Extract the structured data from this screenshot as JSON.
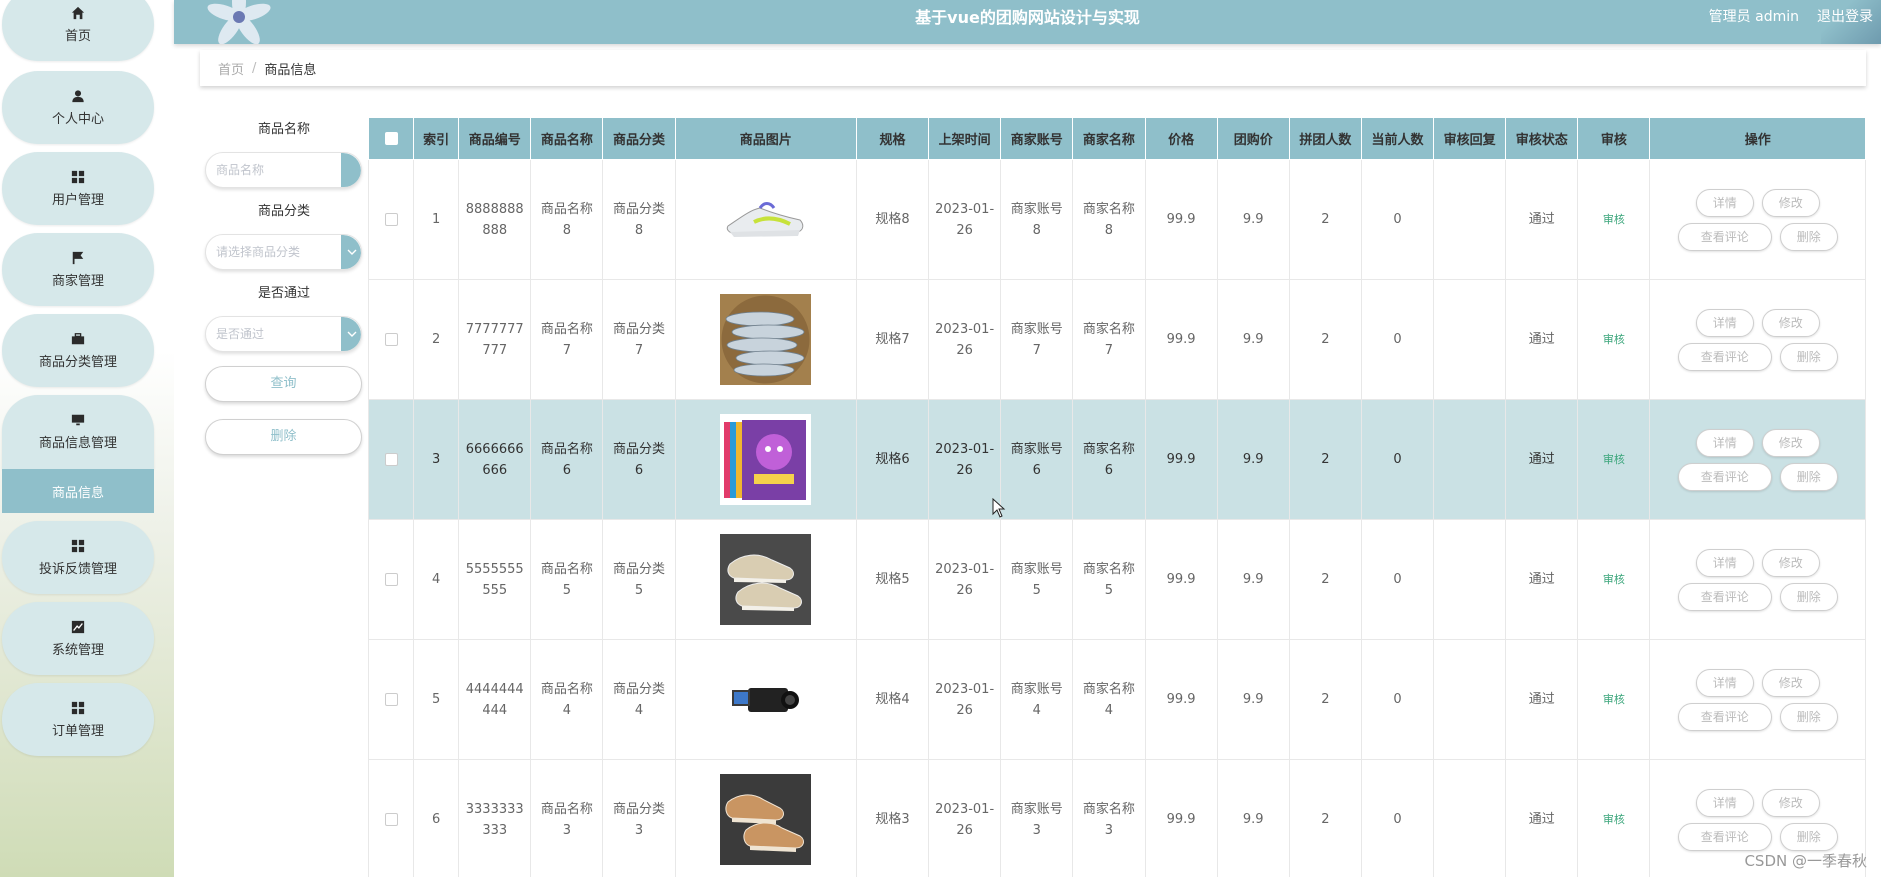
{
  "header": {
    "title": "基于vue的团购网站设计与实现",
    "user": "管理员 admin",
    "logout": "退出登录"
  },
  "sidebar": {
    "items": [
      {
        "label": "首页",
        "icon": "home-icon"
      },
      {
        "label": "个人中心",
        "icon": "user-icon"
      },
      {
        "label": "用户管理",
        "icon": "grid-icon"
      },
      {
        "label": "商家管理",
        "icon": "flag-icon"
      },
      {
        "label": "商品分类管理",
        "icon": "briefcase-icon"
      },
      {
        "label": "商品信息管理",
        "icon": "monitor-icon"
      },
      {
        "label": "投诉反馈管理",
        "icon": "grid-icon"
      },
      {
        "label": "系统管理",
        "icon": "chart-icon"
      },
      {
        "label": "订单管理",
        "icon": "grid-icon"
      }
    ],
    "active_sub": "商品信息"
  },
  "breadcrumb": {
    "home": "首页",
    "sep": "/",
    "current": "商品信息"
  },
  "search": {
    "name_label": "商品名称",
    "name_placeholder": "商品名称",
    "category_label": "商品分类",
    "category_placeholder": "请选择商品分类",
    "pass_label": "是否通过",
    "pass_placeholder": "是否通过",
    "query_button": "查询",
    "delete_button": "删除"
  },
  "table": {
    "headers": [
      "索引",
      "商品编号",
      "商品名称",
      "商品分类",
      "商品图片",
      "规格",
      "上架时间",
      "商家账号",
      "商家名称",
      "价格",
      "团购价",
      "拼团人数",
      "当前人数",
      "审核回复",
      "审核状态",
      "审核",
      "操作"
    ],
    "rows": [
      {
        "index": "1",
        "code": "8888888888",
        "name": "商品名称8",
        "category": "商品分类8",
        "image": "sneaker-image",
        "spec": "规格8",
        "time": "2023-01-26",
        "account": "商家账号8",
        "merchant": "商家名称8",
        "price": "99.9",
        "group_price": "9.9",
        "group_size": "2",
        "current": "0",
        "reply": "",
        "status": "通过",
        "audit": "审核"
      },
      {
        "index": "2",
        "code": "7777777777",
        "name": "商品名称7",
        "category": "商品分类7",
        "image": "fish-image",
        "spec": "规格7",
        "time": "2023-01-26",
        "account": "商家账号7",
        "merchant": "商家名称7",
        "price": "99.9",
        "group_price": "9.9",
        "group_size": "2",
        "current": "0",
        "reply": "",
        "status": "通过",
        "audit": "审核"
      },
      {
        "index": "3",
        "code": "6666666666",
        "name": "商品名称6",
        "category": "商品分类6",
        "image": "books-image",
        "spec": "规格6",
        "time": "2023-01-26",
        "account": "商家账号6",
        "merchant": "商家名称6",
        "price": "99.9",
        "group_price": "9.9",
        "group_size": "2",
        "current": "0",
        "reply": "",
        "status": "通过",
        "audit": "审核"
      },
      {
        "index": "4",
        "code": "5555555555",
        "name": "商品名称5",
        "category": "商品分类5",
        "image": "shoes-image",
        "spec": "规格5",
        "time": "2023-01-26",
        "account": "商家账号5",
        "merchant": "商家名称5",
        "price": "99.9",
        "group_price": "9.9",
        "group_size": "2",
        "current": "0",
        "reply": "",
        "status": "通过",
        "audit": "审核"
      },
      {
        "index": "5",
        "code": "4444444444",
        "name": "商品名称4",
        "category": "商品分类4",
        "image": "camera-image",
        "spec": "规格4",
        "time": "2023-01-26",
        "account": "商家账号4",
        "merchant": "商家名称4",
        "price": "99.9",
        "group_price": "9.9",
        "group_size": "2",
        "current": "0",
        "reply": "",
        "status": "通过",
        "audit": "审核"
      },
      {
        "index": "6",
        "code": "3333333333",
        "name": "商品名称3",
        "category": "商品分类3",
        "image": "brown-shoes-image",
        "spec": "规格3",
        "time": "2023-01-26",
        "account": "商家账号3",
        "merchant": "商家名称3",
        "price": "99.9",
        "group_price": "9.9",
        "group_size": "2",
        "current": "0",
        "reply": "",
        "status": "通过",
        "audit": "审核"
      }
    ],
    "ops": {
      "detail": "详情",
      "edit": "修改",
      "comments": "查看评论",
      "delete": "删除"
    },
    "highlight_row": 2
  },
  "watermark": "CSDN @一季春秋",
  "colors": {
    "accent": "#8fbfca",
    "menu_bg": "#d6e8ea",
    "highlight": "#cae1e4",
    "audit": "#3aa57a"
  }
}
